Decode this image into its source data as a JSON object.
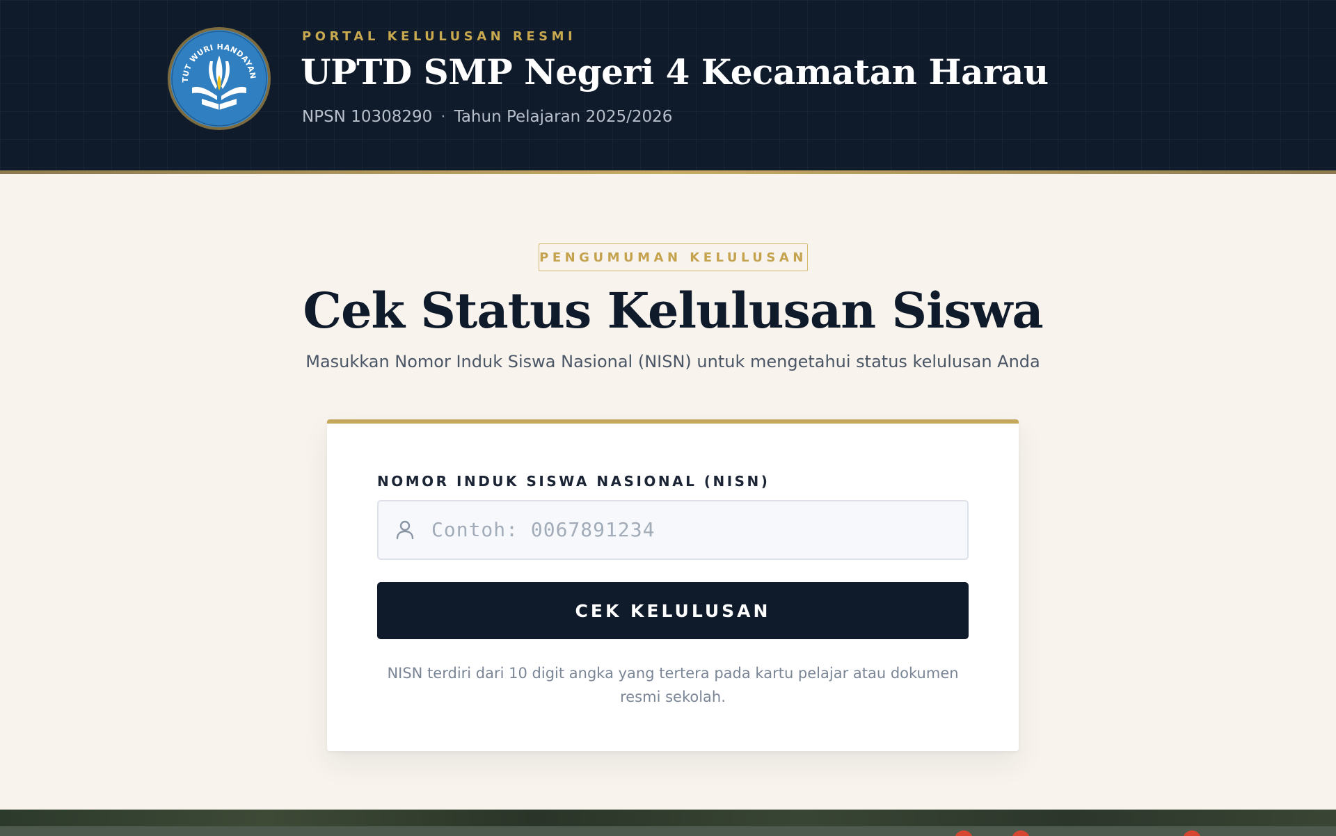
{
  "header": {
    "kicker": "PORTAL KELULUSAN RESMI",
    "school_name": "UPTD SMP Negeri 4 Kecamatan Harau",
    "npsn": "NPSN 10308290",
    "separator": "·",
    "academic_year": "Tahun Pelajaran 2025/2026",
    "logo_text": "TUT WURI HANDAYANI"
  },
  "main": {
    "badge": "PENGUMUMAN KELULUSAN",
    "title": "Cek Status Kelulusan Siswa",
    "subtitle": "Masukkan Nomor Induk Siswa Nasional (NISN) untuk mengetahui status kelulusan Anda"
  },
  "form": {
    "label": "NOMOR INDUK SISWA NASIONAL (NISN)",
    "input_value": "",
    "input_placeholder": "Contoh: 0067891234",
    "input_icon": "user-icon",
    "submit_label": "CEK KELULUSAN",
    "hint": "NISN terdiri dari 10 digit angka yang tertera pada kartu pelajar atau dokumen resmi sekolah."
  },
  "colors": {
    "navy": "#0f1a2b",
    "gold": "#c9a94f",
    "background": "#f8f4ed",
    "logo_blue": "#2f7fc1"
  }
}
